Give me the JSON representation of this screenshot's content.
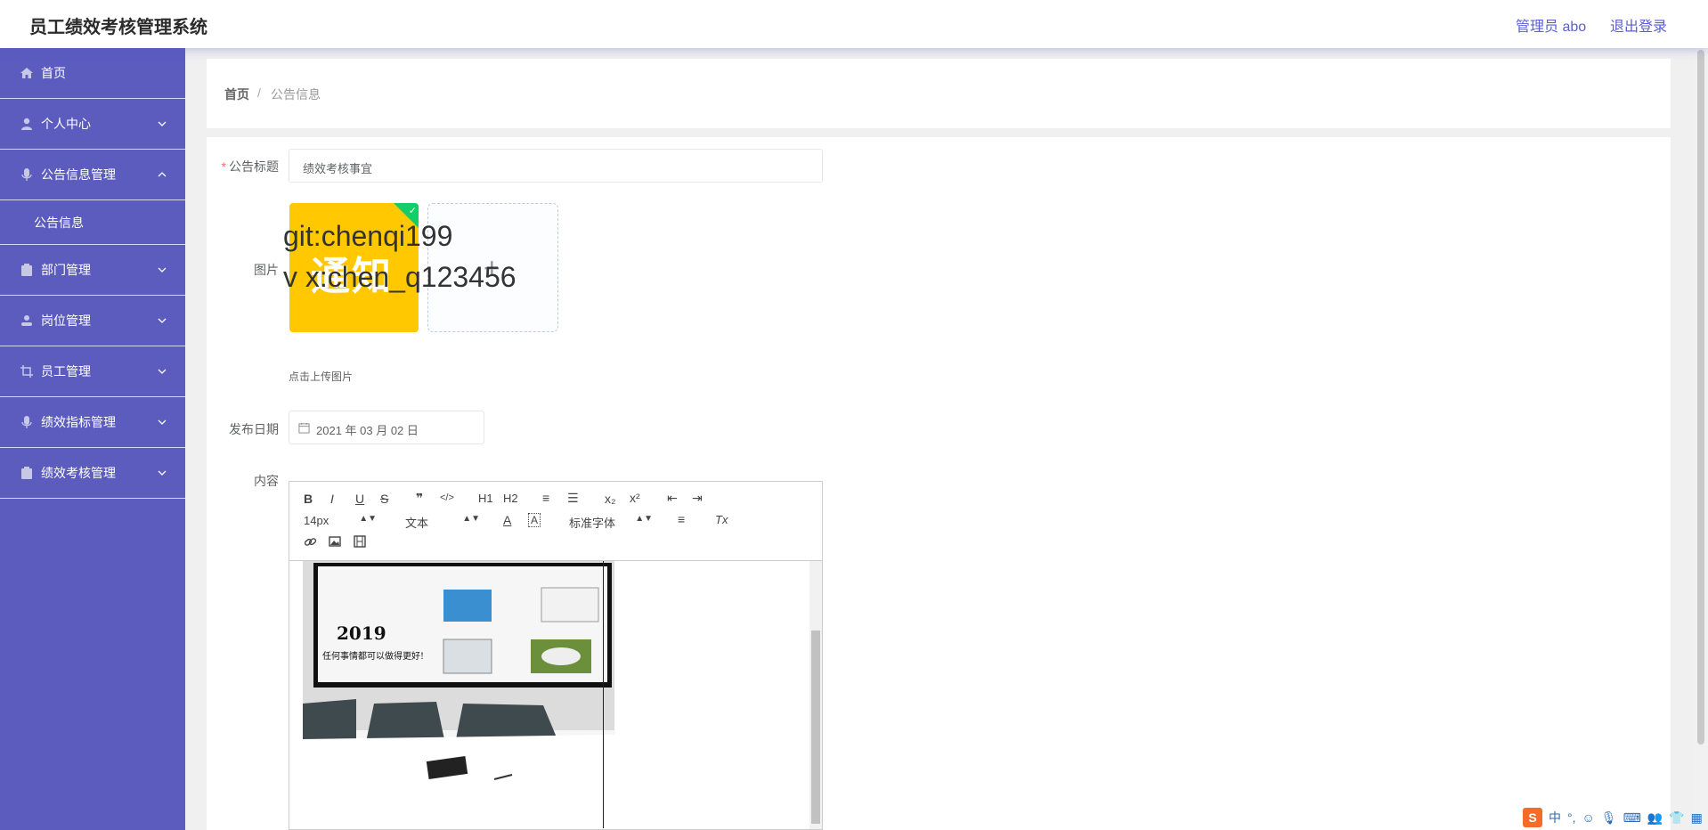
{
  "header": {
    "app_title": "员工绩效考核管理系统",
    "user": "管理员 abo",
    "logout": "退出登录"
  },
  "sidebar": {
    "items": [
      {
        "label": "首页",
        "icon": "home-icon"
      },
      {
        "label": "个人中心",
        "icon": "user-icon"
      },
      {
        "label": "公告信息管理",
        "icon": "mic-icon",
        "expanded": true,
        "sub": [
          {
            "label": "公告信息"
          }
        ]
      },
      {
        "label": "部门管理",
        "icon": "clipboard-icon"
      },
      {
        "label": "岗位管理",
        "icon": "person-icon"
      },
      {
        "label": "员工管理",
        "icon": "crop-icon"
      },
      {
        "label": "绩效指标管理",
        "icon": "mic-icon"
      },
      {
        "label": "绩效考核管理",
        "icon": "clipboard-icon"
      }
    ]
  },
  "breadcrumb": {
    "home": "首页",
    "separator": "/",
    "current": "公告信息"
  },
  "form": {
    "title_label": "公告标题",
    "title_required": "*",
    "title_value": "绩效考核事宜",
    "image_label": "图片",
    "uploaded_image_text": "通知",
    "upload_plus": "+",
    "upload_tip": "点击上传图片",
    "date_label": "发布日期",
    "date_value": "2021 年 03 月 02 日",
    "content_label": "内容"
  },
  "watermark": {
    "line1": "git:chenqi199",
    "line2": "v x:chen_q123456"
  },
  "editor": {
    "toolbar": {
      "row1": [
        "B",
        "I",
        "U",
        "S",
        "❞",
        "</>",
        "H1",
        "H2",
        "≡",
        "☰",
        "x₂",
        "x²",
        "⇤",
        "⇥"
      ],
      "font_size": "14px",
      "header_select": "文本",
      "font_family": "标准字体",
      "row2_buttons": [
        "A",
        "A",
        "≡",
        "Tx"
      ],
      "row3": [
        "link",
        "image",
        "video"
      ]
    },
    "photo": {
      "year": "2019",
      "slogan": "任何事情都可以做得更好!"
    }
  },
  "colors": {
    "sidebar": "#5c5cbf",
    "accent": "#5b5ed0",
    "banner": "#ffc800",
    "success": "#13ce66"
  }
}
